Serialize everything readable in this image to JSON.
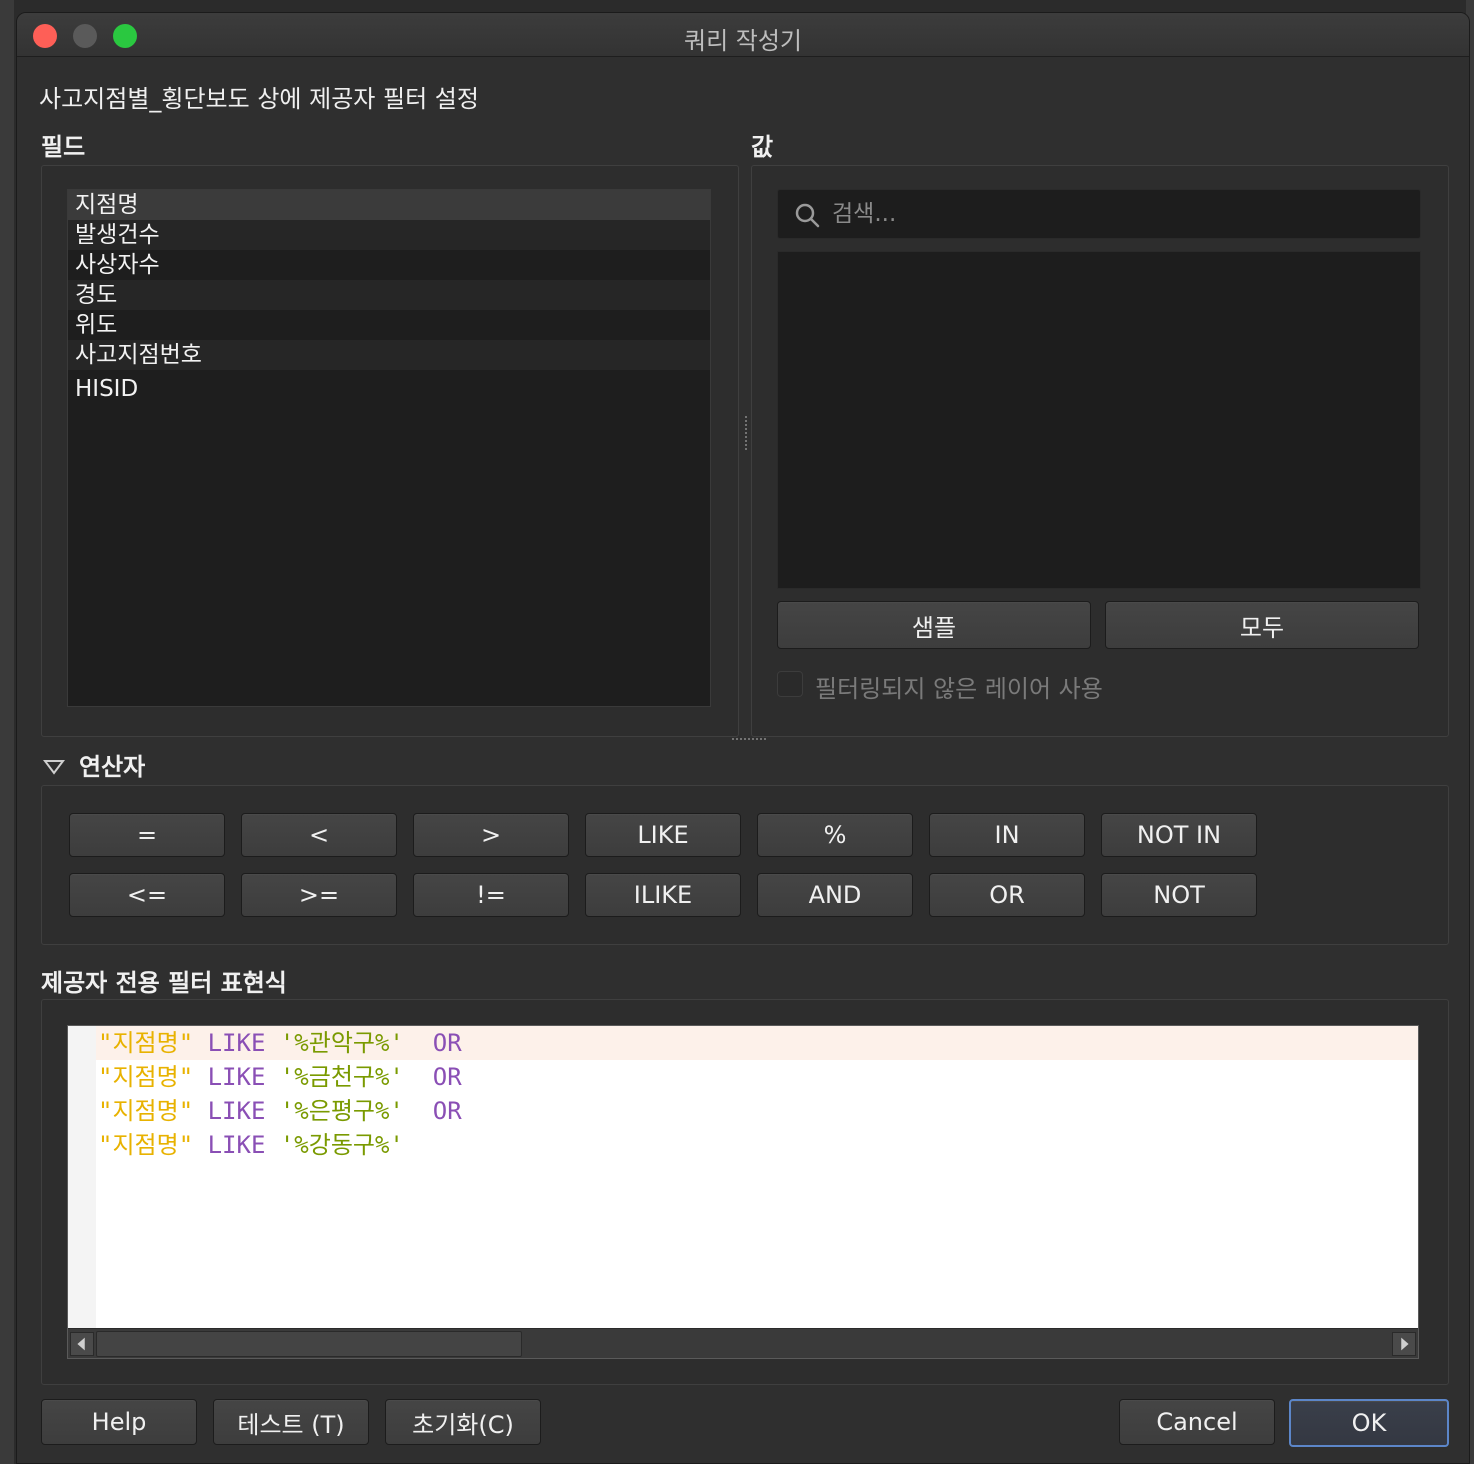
{
  "window": {
    "title": "쿼리 작성기"
  },
  "dialog": {
    "heading": "사고지점별_횡단보도 상에 제공자 필터 설정"
  },
  "fields": {
    "label": "필드",
    "items": [
      "지점명",
      "발생건수",
      "사상자수",
      "경도",
      "위도",
      "사고지점번호",
      "HISID"
    ]
  },
  "values": {
    "label": "값",
    "search_placeholder": "검색...",
    "sample_button": "샘플",
    "all_button": "모두",
    "checkbox_label": "필터링되지 않은 레이어 사용",
    "checkbox_checked": false
  },
  "operators": {
    "label": "연산자",
    "row1": [
      "=",
      "<",
      ">",
      "LIKE",
      "%",
      "IN",
      "NOT IN"
    ],
    "row2": [
      "<=",
      ">=",
      "!=",
      "ILIKE",
      "AND",
      "OR",
      "NOT"
    ]
  },
  "expression": {
    "label": "제공자 전용 필터 표현식",
    "lines": [
      {
        "field": "\"지점명\"",
        "op": "LIKE",
        "value": "'%관악구%'",
        "conj": "OR"
      },
      {
        "field": "\"지점명\"",
        "op": "LIKE",
        "value": "'%금천구%'",
        "conj": "OR"
      },
      {
        "field": "\"지점명\"",
        "op": "LIKE",
        "value": "'%은평구%'",
        "conj": "OR"
      },
      {
        "field": "\"지점명\"",
        "op": "LIKE",
        "value": "'%강동구%'",
        "conj": ""
      }
    ]
  },
  "footer": {
    "help": "Help",
    "test": "테스트 (T)",
    "reset": "초기화(C)",
    "cancel": "Cancel",
    "ok": "OK"
  },
  "colors": {
    "field_token": "#e8b200",
    "keyword_token": "#8a4fb5",
    "string_token": "#7a9a00",
    "ok_border": "#5c86c9"
  }
}
